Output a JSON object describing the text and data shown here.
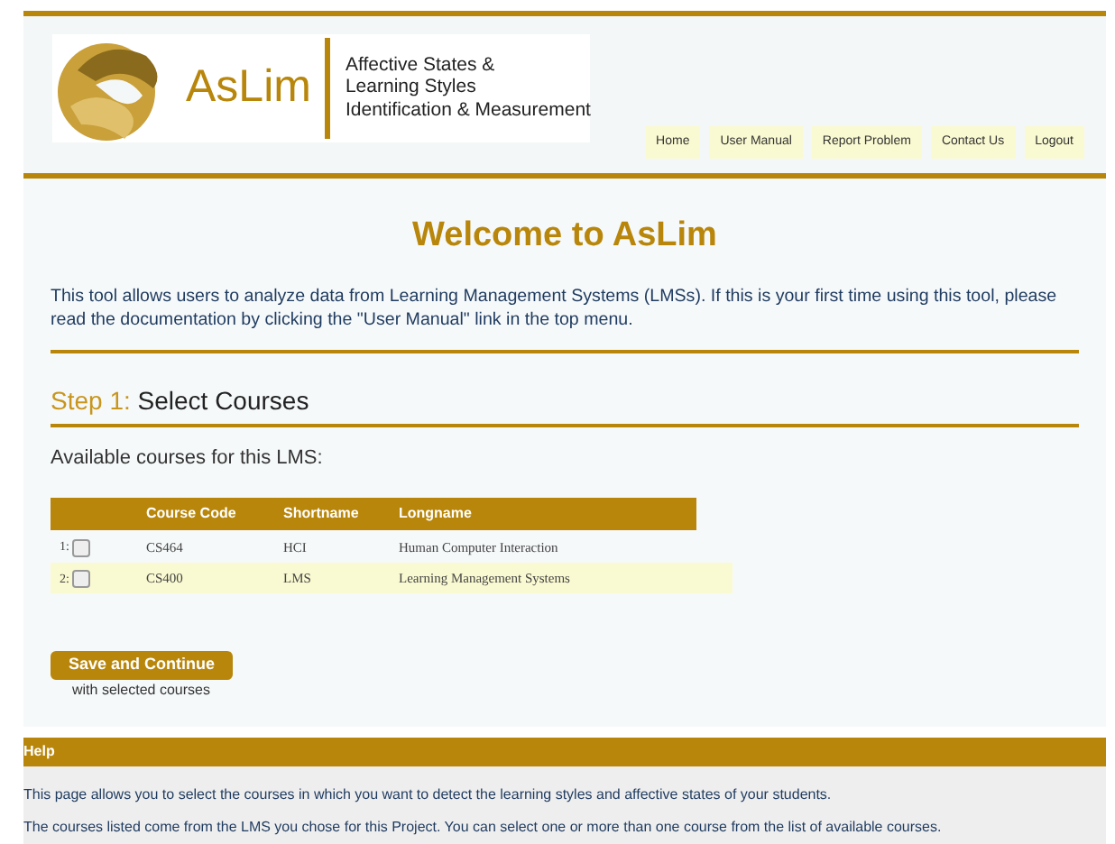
{
  "header": {
    "logo_text": "AsLim",
    "tagline": [
      "Affective States &",
      "Learning Styles",
      "Identification & Measurement"
    ],
    "menu": [
      {
        "label": "Home"
      },
      {
        "label": "User Manual"
      },
      {
        "label": "Report Problem"
      },
      {
        "label": "Contact Us"
      },
      {
        "label": "Logout"
      }
    ]
  },
  "title": "Welcome to AsLim",
  "intro": "This tool allows users to analyze data from Learning Management Systems (LMSs). If this is your first time using this tool, please read the documentation by clicking the \"User Manual\" link in the top menu.",
  "step": {
    "prefix": "Step 1:",
    "title": "Select Courses"
  },
  "subtitle": "Available courses for this LMS:",
  "table": {
    "columns": [
      "Course Code",
      "Shortname",
      "Longname"
    ],
    "rows": [
      {
        "index": "1:",
        "checked": false,
        "cells": [
          "CS464",
          "HCI",
          "Human Computer Interaction"
        ]
      },
      {
        "index": "2:",
        "checked": false,
        "cells": [
          "CS400",
          "LMS",
          "Learning Management Systems"
        ]
      }
    ]
  },
  "save_button": "Save and Continue",
  "save_note": "with selected courses",
  "help": {
    "title": "Help",
    "paragraphs": [
      "This page allows you to select the courses in which you want to detect the learning styles and affective states of your students.",
      "The courses listed come from the LMS you chose for this Project. You can select one or more than one course from the list of available courses."
    ]
  }
}
